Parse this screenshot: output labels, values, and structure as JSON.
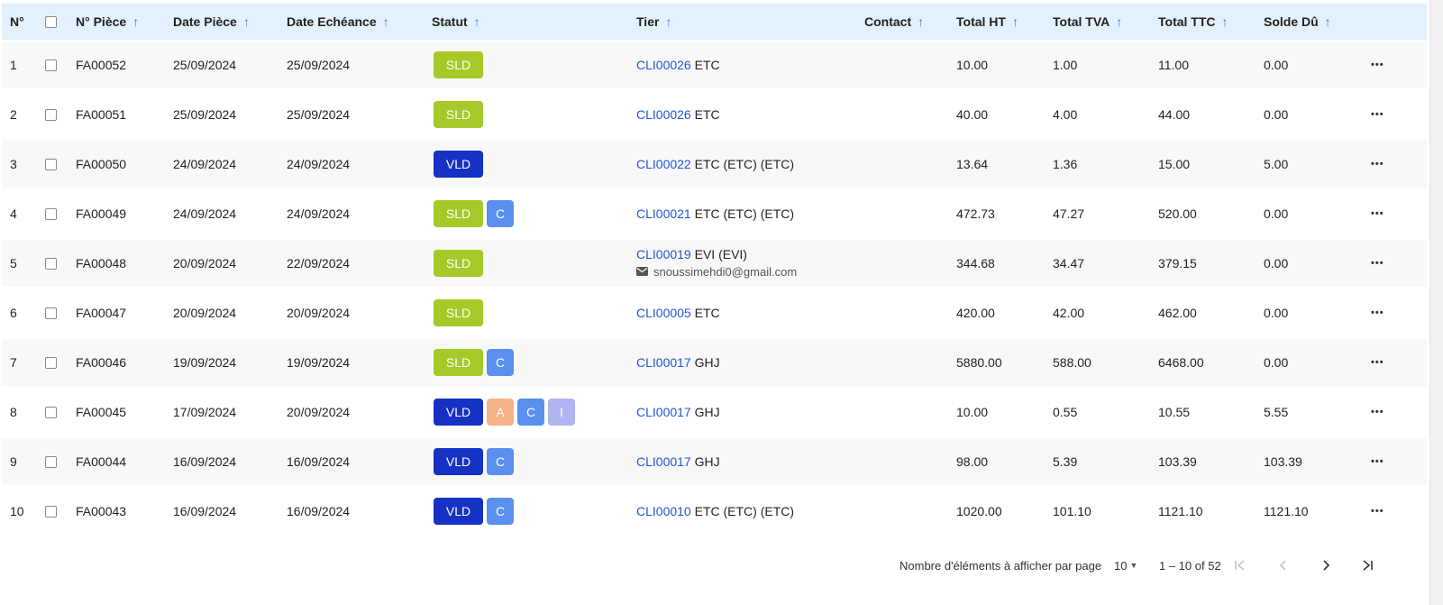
{
  "columns": {
    "num": "N°",
    "piece": "N° Pièce",
    "date_piece": "Date Pièce",
    "date_echeance": "Date Echéance",
    "statut": "Statut",
    "tier": "Tier",
    "contact": "Contact",
    "total_ht": "Total HT",
    "total_tva": "Total TVA",
    "total_ttc": "Total TTC",
    "solde": "Solde Dû"
  },
  "rows": [
    {
      "num": "1",
      "piece": "FA00052",
      "date_piece": "25/09/2024",
      "date_echeance": "25/09/2024",
      "badges": [
        {
          "text": "SLD",
          "type": "sld"
        }
      ],
      "tier_code": "CLI00026",
      "tier_name": " ETC",
      "email": "",
      "contact": "",
      "total_ht": "10.00",
      "total_tva": "1.00",
      "total_ttc": "11.00",
      "solde": "0.00"
    },
    {
      "num": "2",
      "piece": "FA00051",
      "date_piece": "25/09/2024",
      "date_echeance": "25/09/2024",
      "badges": [
        {
          "text": "SLD",
          "type": "sld"
        }
      ],
      "tier_code": "CLI00026",
      "tier_name": " ETC",
      "email": "",
      "contact": "",
      "total_ht": "40.00",
      "total_tva": "4.00",
      "total_ttc": "44.00",
      "solde": "0.00"
    },
    {
      "num": "3",
      "piece": "FA00050",
      "date_piece": "24/09/2024",
      "date_echeance": "24/09/2024",
      "badges": [
        {
          "text": "VLD",
          "type": "vld"
        }
      ],
      "tier_code": "CLI00022",
      "tier_name": " ETC (ETC) (ETC)",
      "email": "",
      "contact": "",
      "total_ht": "13.64",
      "total_tva": "1.36",
      "total_ttc": "15.00",
      "solde": "5.00"
    },
    {
      "num": "4",
      "piece": "FA00049",
      "date_piece": "24/09/2024",
      "date_echeance": "24/09/2024",
      "badges": [
        {
          "text": "SLD",
          "type": "sld"
        },
        {
          "text": "C",
          "type": "c"
        }
      ],
      "tier_code": "CLI00021",
      "tier_name": " ETC (ETC) (ETC)",
      "email": "",
      "contact": "",
      "total_ht": "472.73",
      "total_tva": "47.27",
      "total_ttc": "520.00",
      "solde": "0.00"
    },
    {
      "num": "5",
      "piece": "FA00048",
      "date_piece": "20/09/2024",
      "date_echeance": "22/09/2024",
      "badges": [
        {
          "text": "SLD",
          "type": "sld"
        }
      ],
      "tier_code": "CLI00019",
      "tier_name": " EVI (EVI)",
      "email": "snoussimehdi0@gmail.com",
      "contact": "",
      "total_ht": "344.68",
      "total_tva": "34.47",
      "total_ttc": "379.15",
      "solde": "0.00"
    },
    {
      "num": "6",
      "piece": "FA00047",
      "date_piece": "20/09/2024",
      "date_echeance": "20/09/2024",
      "badges": [
        {
          "text": "SLD",
          "type": "sld"
        }
      ],
      "tier_code": "CLI00005",
      "tier_name": " ETC",
      "email": "",
      "contact": "",
      "total_ht": "420.00",
      "total_tva": "42.00",
      "total_ttc": "462.00",
      "solde": "0.00"
    },
    {
      "num": "7",
      "piece": "FA00046",
      "date_piece": "19/09/2024",
      "date_echeance": "19/09/2024",
      "badges": [
        {
          "text": "SLD",
          "type": "sld"
        },
        {
          "text": "C",
          "type": "c"
        }
      ],
      "tier_code": "CLI00017",
      "tier_name": " GHJ",
      "email": "",
      "contact": "",
      "total_ht": "5880.00",
      "total_tva": "588.00",
      "total_ttc": "6468.00",
      "solde": "0.00"
    },
    {
      "num": "8",
      "piece": "FA00045",
      "date_piece": "17/09/2024",
      "date_echeance": "20/09/2024",
      "badges": [
        {
          "text": "VLD",
          "type": "vld"
        },
        {
          "text": "A",
          "type": "a"
        },
        {
          "text": "C",
          "type": "c"
        },
        {
          "text": "I",
          "type": "i"
        }
      ],
      "tier_code": "CLI00017",
      "tier_name": " GHJ",
      "email": "",
      "contact": "",
      "total_ht": "10.00",
      "total_tva": "0.55",
      "total_ttc": "10.55",
      "solde": "5.55"
    },
    {
      "num": "9",
      "piece": "FA00044",
      "date_piece": "16/09/2024",
      "date_echeance": "16/09/2024",
      "badges": [
        {
          "text": "VLD",
          "type": "vld"
        },
        {
          "text": "C",
          "type": "c"
        }
      ],
      "tier_code": "CLI00017",
      "tier_name": " GHJ",
      "email": "",
      "contact": "",
      "total_ht": "98.00",
      "total_tva": "5.39",
      "total_ttc": "103.39",
      "solde": "103.39"
    },
    {
      "num": "10",
      "piece": "FA00043",
      "date_piece": "16/09/2024",
      "date_echeance": "16/09/2024",
      "badges": [
        {
          "text": "VLD",
          "type": "vld"
        },
        {
          "text": "C",
          "type": "c"
        }
      ],
      "tier_code": "CLI00010",
      "tier_name": " ETC (ETC) (ETC)",
      "email": "",
      "contact": "",
      "total_ht": "1020.00",
      "total_tva": "101.10",
      "total_ttc": "1121.10",
      "solde": "1121.10"
    }
  ],
  "row_actions_label": "•••",
  "pagination": {
    "items_per_page_label": "Nombre d'éléments à afficher par page",
    "page_size": "10",
    "range": "1 – 10 of 52"
  },
  "colors": {
    "header_bg": "#e3f0fd",
    "row_alt_bg": "#f8f8f8",
    "sld": "#a4c928",
    "vld": "#1532c4",
    "c_badge": "#5b8ff0",
    "a_badge": "#f5b389",
    "i_badge": "#b0b4f1",
    "link": "#1e57d8",
    "sort_arrow": "#2f7de1"
  }
}
